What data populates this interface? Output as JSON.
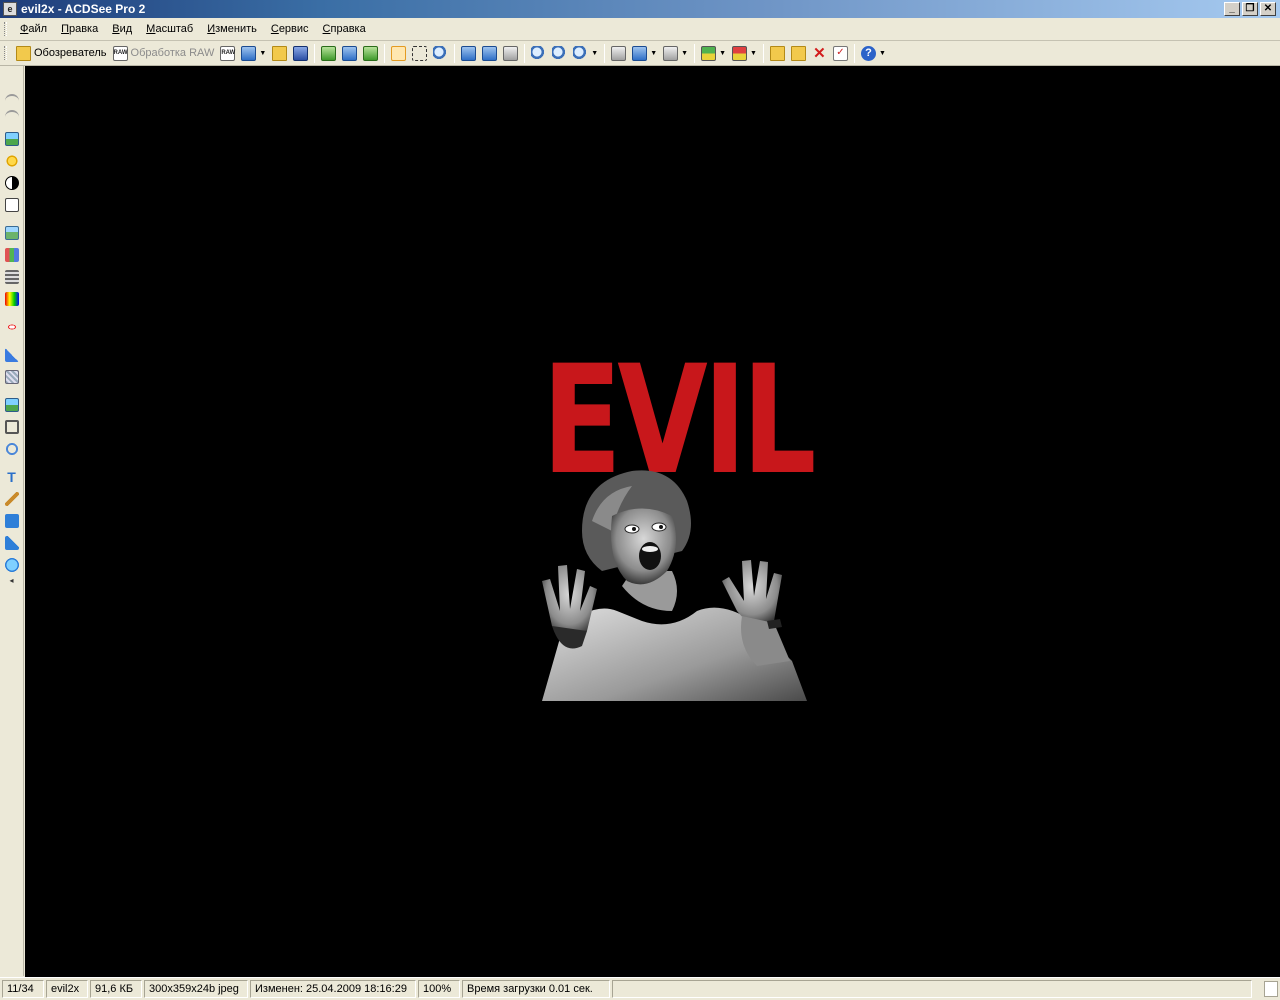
{
  "window": {
    "title": "evil2x - ACDSee Pro 2",
    "app_icon_glyph": "e",
    "minimize_glyph": "_",
    "restore_glyph": "❐",
    "close_glyph": "✕"
  },
  "menu": {
    "items": [
      "Файл",
      "Правка",
      "Вид",
      "Масштаб",
      "Изменить",
      "Сервис",
      "Справка"
    ]
  },
  "toolbar": {
    "browser_label": "Обозреватель",
    "raw_label": "Обработка RAW",
    "raw_icon_text": "RAW",
    "delete_glyph": "✕",
    "help_glyph": "?",
    "check_glyph": "✓",
    "dropdown_glyph": "▼"
  },
  "lefttools": {
    "text_tool_glyph": "T",
    "collapse_glyph": "◂"
  },
  "image": {
    "headline": "EVIL",
    "headline_color": "#c8171b",
    "background_color": "#000000"
  },
  "status": {
    "index": "11/34",
    "filename": "evil2x",
    "filesize": "91,6 КБ",
    "dimensions": "300x359x24b jpeg",
    "modified": "Изменен: 25.04.2009 18:16:29",
    "zoom": "100%",
    "load_time": "Время загрузки 0.01 сек."
  }
}
